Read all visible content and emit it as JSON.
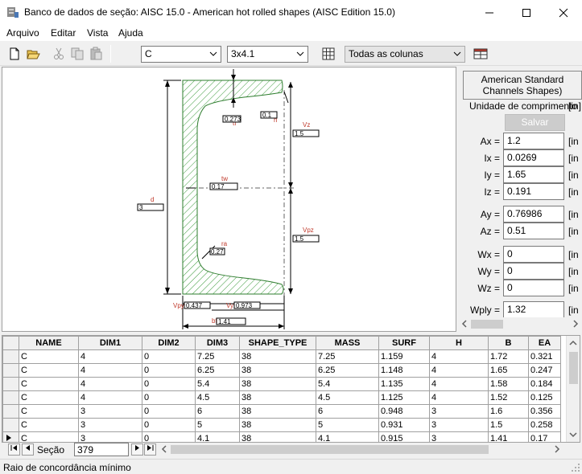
{
  "window": {
    "title": "Banco de dados de seção: AISC 15.0 - American hot rolled shapes (AISC Edition 15.0)"
  },
  "menu": [
    "Arquivo",
    "Editar",
    "Vista",
    "Ajuda"
  ],
  "toolbar": {
    "shape_select": "C",
    "section_select": "3x4.1",
    "columns_select": "Todas as colunas"
  },
  "drawing": {
    "labels": {
      "tf": "tf",
      "tf_val": "0.273",
      "ri": "ri",
      "ri_val": "0.1",
      "vz": "Vz",
      "vz_val": "1.5",
      "tw": "tw",
      "tw_val": "0.17",
      "d": "d",
      "d_val": "3",
      "vpz": "Vpz",
      "vpz_val": "1.5",
      "ra": "ra",
      "ra_val": "0.27",
      "vpy": "Vpy",
      "vpy_val": "0.437",
      "vy": "Vy",
      "vy_val": "0.973",
      "bf": "bf",
      "bf_val": "1.41"
    }
  },
  "rpanel": {
    "heading": "American Standard Channels Shapes)",
    "length_unit_label": "Unidade de comprimento",
    "length_unit": "[in]",
    "save_label": "Salvar",
    "props": [
      {
        "label": "Ax =",
        "value": "1.2",
        "unit": "[in"
      },
      {
        "label": "Ix =",
        "value": "0.0269",
        "unit": "[in"
      },
      {
        "label": "Iy =",
        "value": "1.65",
        "unit": "[in"
      },
      {
        "label": "Iz =",
        "value": "0.191",
        "unit": "[in"
      },
      {
        "label": "Ay =",
        "value": "0.76986",
        "unit": "[in"
      },
      {
        "label": "Az =",
        "value": "0.51",
        "unit": "[in"
      },
      {
        "label": "Wx =",
        "value": "0",
        "unit": "[in"
      },
      {
        "label": "Wy =",
        "value": "0",
        "unit": "[in"
      },
      {
        "label": "Wz =",
        "value": "0",
        "unit": "[in"
      },
      {
        "label": "Wply =",
        "value": "1.32",
        "unit": "[in"
      }
    ]
  },
  "table": {
    "columns": [
      "NAME",
      "DIM1",
      "DIM2",
      "DIM3",
      "SHAPE_TYPE",
      "MASS",
      "SURF",
      "H",
      "B",
      "EA"
    ],
    "rows": [
      [
        "C",
        "4",
        "0",
        "7.25",
        "38",
        "7.25",
        "1.159",
        "4",
        "1.72",
        "0.321"
      ],
      [
        "C",
        "4",
        "0",
        "6.25",
        "38",
        "6.25",
        "1.148",
        "4",
        "1.65",
        "0.247"
      ],
      [
        "C",
        "4",
        "0",
        "5.4",
        "38",
        "5.4",
        "1.135",
        "4",
        "1.58",
        "0.184"
      ],
      [
        "C",
        "4",
        "0",
        "4.5",
        "38",
        "4.5",
        "1.125",
        "4",
        "1.52",
        "0.125"
      ],
      [
        "C",
        "3",
        "0",
        "6",
        "38",
        "6",
        "0.948",
        "3",
        "1.6",
        "0.356"
      ],
      [
        "C",
        "3",
        "0",
        "5",
        "38",
        "5",
        "0.931",
        "3",
        "1.5",
        "0.258"
      ],
      [
        "C",
        "3",
        "0",
        "4.1",
        "38",
        "4.1",
        "0.915",
        "3",
        "1.41",
        "0.17"
      ]
    ]
  },
  "nav": {
    "label": "Seção",
    "record": "379"
  },
  "status": {
    "text": "Raio de concordância mínimo"
  }
}
